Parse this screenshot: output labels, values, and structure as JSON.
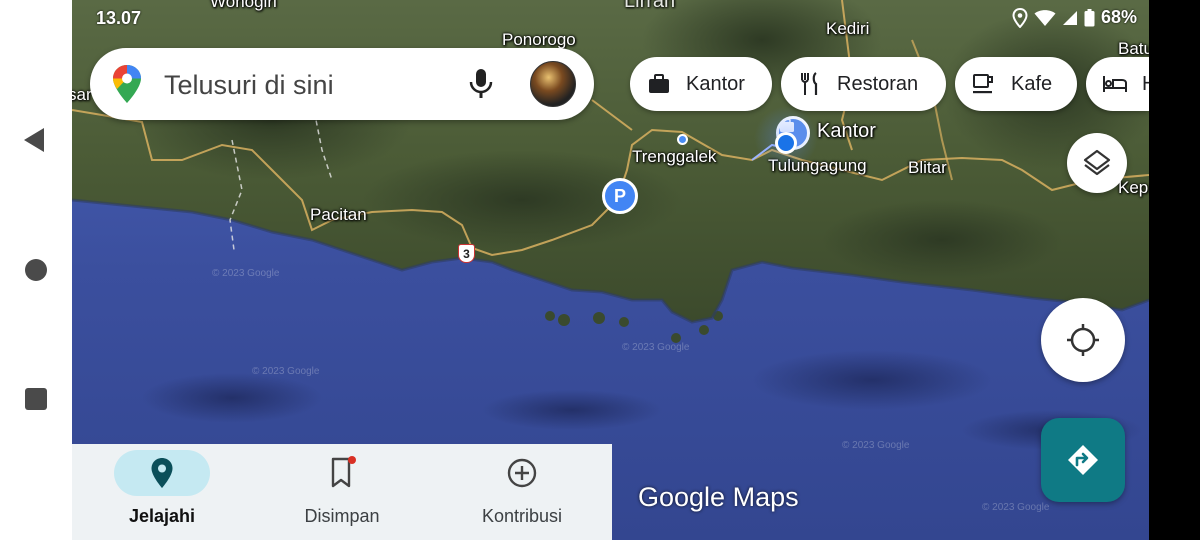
{
  "status": {
    "time": "13.07",
    "battery": "68%"
  },
  "search": {
    "placeholder": "Telusuri di sini"
  },
  "chips": [
    {
      "label": "Kantor",
      "icon": "briefcase-icon"
    },
    {
      "label": "Restoran",
      "icon": "fork-knife-icon"
    },
    {
      "label": "Kafe",
      "icon": "coffee-cup-icon"
    },
    {
      "label": "H",
      "icon": "bed-icon"
    }
  ],
  "map": {
    "labels": {
      "top_left_clip": "Wonogiri",
      "top_center_clip": "Lirran",
      "ponorogo": "Ponorogo",
      "kediri": "Kediri",
      "batu": "Batu",
      "left_edge": "sar",
      "trenggalek": "Trenggalek",
      "tulungagung": "Tulungagung",
      "blitar": "Blitar",
      "kepanjen": "Kep",
      "pacitan": "Pacitan"
    },
    "saved_place_label": "Kantor",
    "road_shield": "3",
    "watermark": "© 2023 Google"
  },
  "wordmark": {
    "brand": "Google",
    "product": "Maps"
  },
  "bottom_nav": {
    "items": [
      {
        "label": "Jelajahi",
        "icon": "location-pin-icon",
        "active": true
      },
      {
        "label": "Disimpan",
        "icon": "bookmark-icon",
        "active": false
      },
      {
        "label": "Kontribusi",
        "icon": "add-circle-icon",
        "active": false
      }
    ]
  },
  "colors": {
    "accent": "#0f7a85",
    "ocean": "#3c4fa0",
    "land": "#4a5a35",
    "active_tab": "#c5e9f2"
  }
}
